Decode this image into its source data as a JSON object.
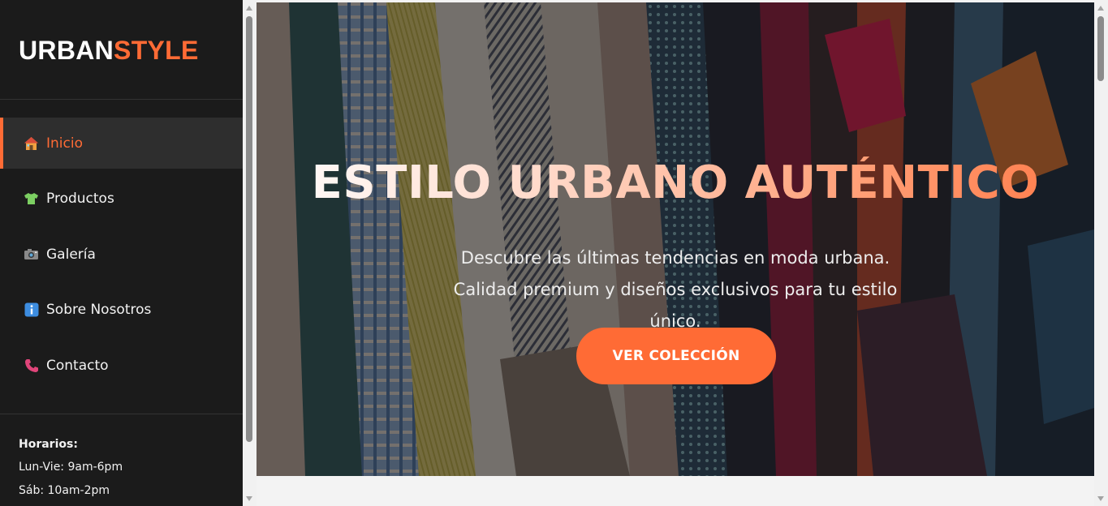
{
  "brand": {
    "part1": "URBAN",
    "part2": "STYLE",
    "accent_color": "#ff6b35"
  },
  "nav": {
    "items": [
      {
        "label": "Inicio",
        "icon": "house-icon",
        "active": true
      },
      {
        "label": "Productos",
        "icon": "tshirt-icon",
        "active": false
      },
      {
        "label": "Galería",
        "icon": "camera-icon",
        "active": false
      },
      {
        "label": "Sobre Nosotros",
        "icon": "info-icon",
        "active": false
      },
      {
        "label": "Contacto",
        "icon": "phone-icon",
        "active": false
      }
    ]
  },
  "hours": {
    "title": "Horarios:",
    "weekday": "Lun-Vie: 9am-6pm",
    "saturday": "Sáb: 10am-2pm"
  },
  "hero": {
    "title": "ESTILO URBANO AUTÉNTICO",
    "subtitle": "Descubre las últimas tendencias en moda urbana. Calidad premium y diseños exclusivos para tu estilo único.",
    "button_label": "VER COLECCIÓN"
  }
}
